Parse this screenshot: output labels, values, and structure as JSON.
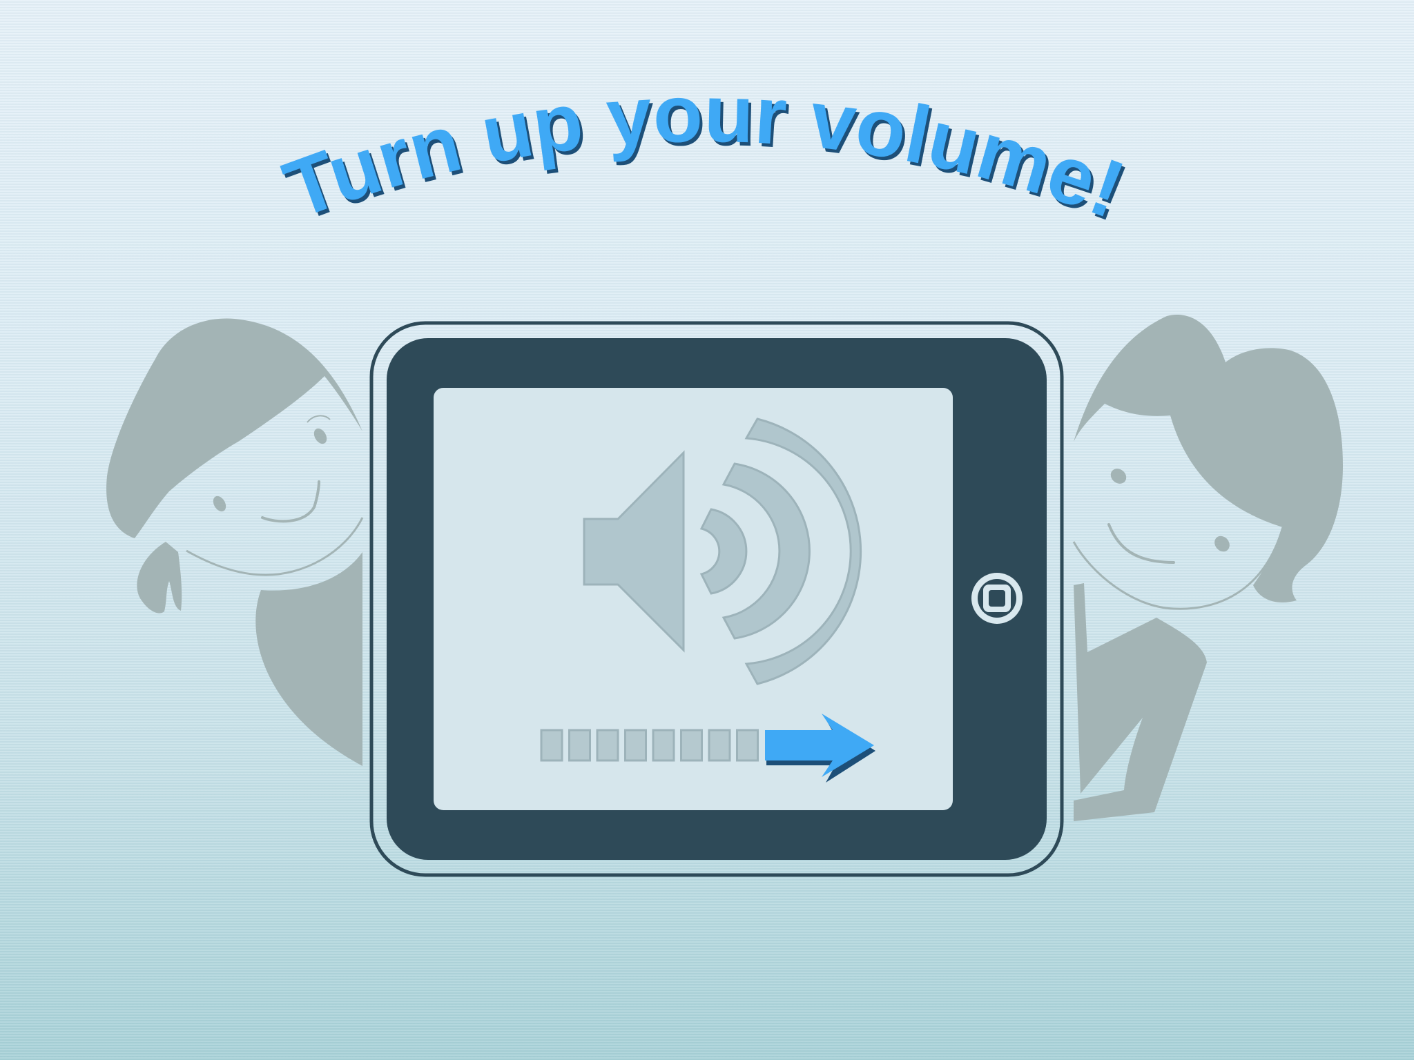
{
  "splash": {
    "title": "Turn up your volume!"
  },
  "device": {
    "type": "tablet",
    "home_button_icon": "home-button-icon",
    "screen_icon": "speaker-volume-icon"
  },
  "volume_meter": {
    "segment_count": 8,
    "direction_icon": "arrow-right-icon"
  },
  "characters": [
    "girl-left",
    "boy-right"
  ],
  "colors": {
    "accent": "#3fa9f5",
    "accent_shadow": "#1d4f78",
    "device_body": "#2e4a58",
    "device_outline": "#2e4a58",
    "screen_bg": "#d6e6ec",
    "silhouette": "#a3b4b5",
    "speaker_icon": "#b0c6cd"
  }
}
